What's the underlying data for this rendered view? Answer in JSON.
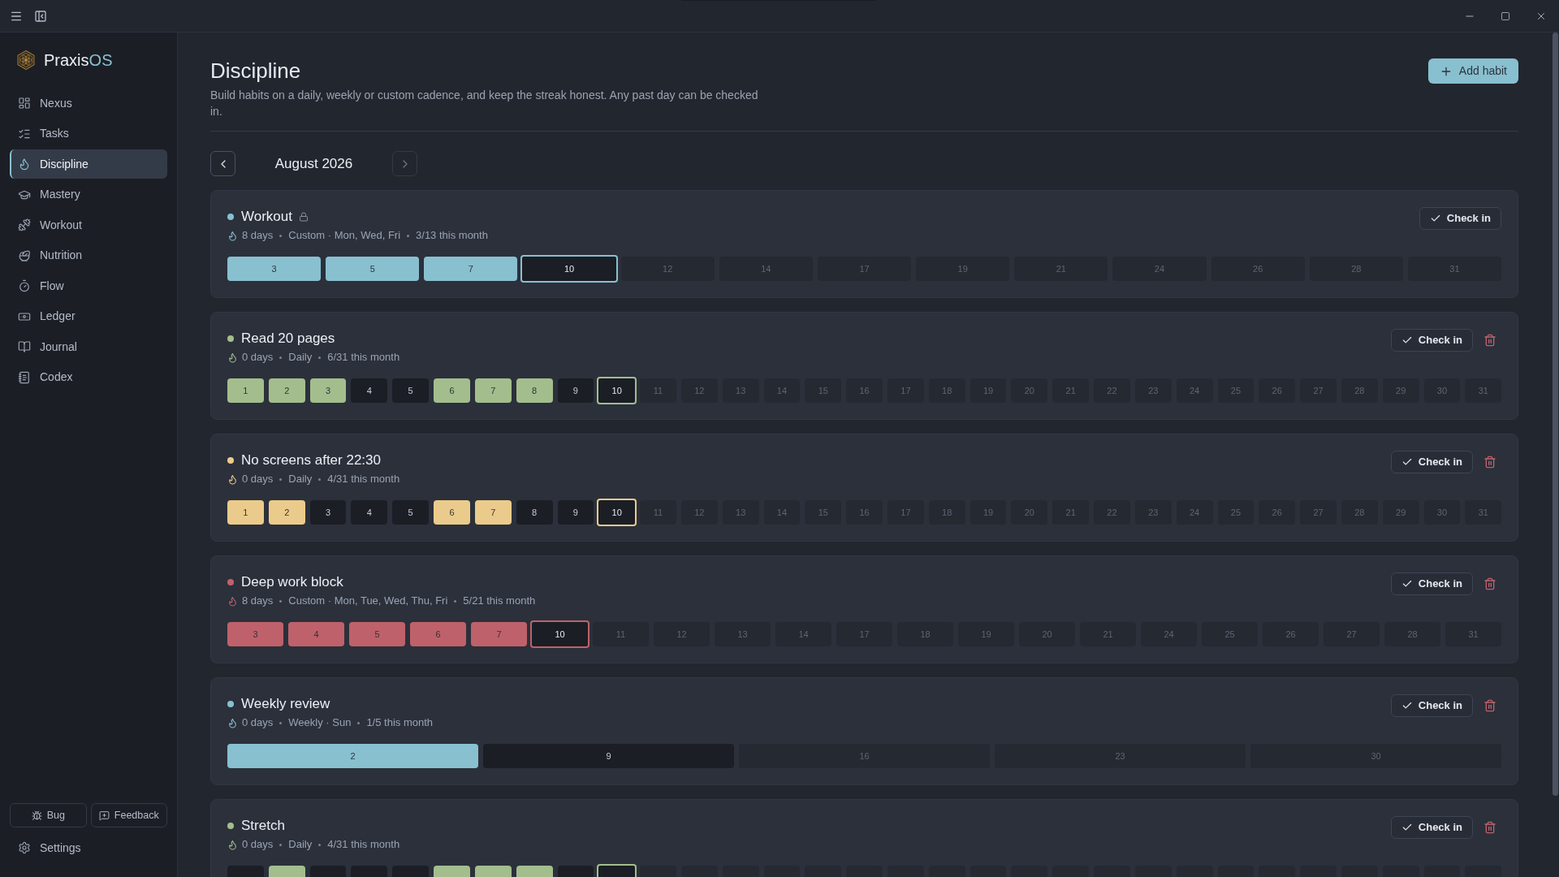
{
  "sidebar": {
    "brand": {
      "name": "Praxis",
      "accent": "OS"
    },
    "items": [
      {
        "label": "Nexus",
        "selected": false
      },
      {
        "label": "Tasks",
        "selected": false
      },
      {
        "label": "Discipline",
        "selected": true
      },
      {
        "label": "Mastery",
        "selected": false
      },
      {
        "label": "Workout",
        "selected": false
      },
      {
        "label": "Nutrition",
        "selected": false
      },
      {
        "label": "Flow",
        "selected": false
      },
      {
        "label": "Ledger",
        "selected": false
      },
      {
        "label": "Journal",
        "selected": false
      },
      {
        "label": "Codex",
        "selected": false
      }
    ],
    "footer_buttons": [
      "Bug",
      "Feedback"
    ],
    "settings": "Settings"
  },
  "page": {
    "title": "Discipline",
    "description": "Build habits on a daily, weekly or custom cadence, and keep the streak honest. Any past day can be checked in.",
    "add_button": "Add habit"
  },
  "month_nav": {
    "label": "August 2026",
    "prev": {
      "disabled": false
    },
    "next": {
      "disabled": true
    }
  },
  "habits": [
    {
      "name": "Workout",
      "color": "#88c0d0",
      "locked": true,
      "meta": [
        "8 days",
        "Custom · Mon, Wed, Fri",
        "3/13 this month"
      ],
      "check_in": "Check in",
      "days": [
        {
          "label": "3",
          "kind": "done"
        },
        {
          "label": "5",
          "kind": "done"
        },
        {
          "label": "7",
          "kind": "done"
        },
        {
          "label": "10",
          "kind": "today"
        },
        {
          "label": "12",
          "kind": "upcoming"
        },
        {
          "label": "14",
          "kind": "upcoming"
        },
        {
          "label": "17",
          "kind": "upcoming"
        },
        {
          "label": "19",
          "kind": "upcoming"
        },
        {
          "label": "21",
          "kind": "upcoming"
        },
        {
          "label": "24",
          "kind": "upcoming"
        },
        {
          "label": "26",
          "kind": "upcoming"
        },
        {
          "label": "28",
          "kind": "upcoming"
        },
        {
          "label": "31",
          "kind": "upcoming"
        }
      ]
    },
    {
      "name": "Read 20 pages",
      "color": "#a3be8c",
      "locked": false,
      "meta": [
        "0 days",
        "Daily",
        "6/31 this month"
      ],
      "check_in": "Check in",
      "days": [
        {
          "label": "1",
          "kind": "done"
        },
        {
          "label": "2",
          "kind": "done"
        },
        {
          "label": "3",
          "kind": "done"
        },
        {
          "label": "4",
          "kind": "missed"
        },
        {
          "label": "5",
          "kind": "missed"
        },
        {
          "label": "6",
          "kind": "done"
        },
        {
          "label": "7",
          "kind": "done"
        },
        {
          "label": "8",
          "kind": "done"
        },
        {
          "label": "9",
          "kind": "missed"
        },
        {
          "label": "10",
          "kind": "today"
        },
        {
          "label": "11",
          "kind": "upcoming"
        },
        {
          "label": "12",
          "kind": "upcoming"
        },
        {
          "label": "13",
          "kind": "upcoming"
        },
        {
          "label": "14",
          "kind": "upcoming"
        },
        {
          "label": "15",
          "kind": "upcoming"
        },
        {
          "label": "16",
          "kind": "upcoming"
        },
        {
          "label": "17",
          "kind": "upcoming"
        },
        {
          "label": "18",
          "kind": "upcoming"
        },
        {
          "label": "19",
          "kind": "upcoming"
        },
        {
          "label": "20",
          "kind": "upcoming"
        },
        {
          "label": "21",
          "kind": "upcoming"
        },
        {
          "label": "22",
          "kind": "upcoming"
        },
        {
          "label": "23",
          "kind": "upcoming"
        },
        {
          "label": "24",
          "kind": "upcoming"
        },
        {
          "label": "25",
          "kind": "upcoming"
        },
        {
          "label": "26",
          "kind": "upcoming"
        },
        {
          "label": "27",
          "kind": "upcoming"
        },
        {
          "label": "28",
          "kind": "upcoming"
        },
        {
          "label": "29",
          "kind": "upcoming"
        },
        {
          "label": "30",
          "kind": "upcoming"
        },
        {
          "label": "31",
          "kind": "upcoming"
        }
      ]
    },
    {
      "name": "No screens after 22:30",
      "color": "#ebcb8b",
      "locked": false,
      "meta": [
        "0 days",
        "Daily",
        "4/31 this month"
      ],
      "check_in": "Check in",
      "days": [
        {
          "label": "1",
          "kind": "done"
        },
        {
          "label": "2",
          "kind": "done"
        },
        {
          "label": "3",
          "kind": "missed"
        },
        {
          "label": "4",
          "kind": "missed"
        },
        {
          "label": "5",
          "kind": "missed"
        },
        {
          "label": "6",
          "kind": "done"
        },
        {
          "label": "7",
          "kind": "done"
        },
        {
          "label": "8",
          "kind": "missed"
        },
        {
          "label": "9",
          "kind": "missed"
        },
        {
          "label": "10",
          "kind": "today"
        },
        {
          "label": "11",
          "kind": "upcoming"
        },
        {
          "label": "12",
          "kind": "upcoming"
        },
        {
          "label": "13",
          "kind": "upcoming"
        },
        {
          "label": "14",
          "kind": "upcoming"
        },
        {
          "label": "15",
          "kind": "upcoming"
        },
        {
          "label": "16",
          "kind": "upcoming"
        },
        {
          "label": "17",
          "kind": "upcoming"
        },
        {
          "label": "18",
          "kind": "upcoming"
        },
        {
          "label": "19",
          "kind": "upcoming"
        },
        {
          "label": "20",
          "kind": "upcoming"
        },
        {
          "label": "21",
          "kind": "upcoming"
        },
        {
          "label": "22",
          "kind": "upcoming"
        },
        {
          "label": "23",
          "kind": "upcoming"
        },
        {
          "label": "24",
          "kind": "upcoming"
        },
        {
          "label": "25",
          "kind": "upcoming"
        },
        {
          "label": "26",
          "kind": "upcoming"
        },
        {
          "label": "27",
          "kind": "upcoming"
        },
        {
          "label": "28",
          "kind": "upcoming"
        },
        {
          "label": "29",
          "kind": "upcoming"
        },
        {
          "label": "30",
          "kind": "upcoming"
        },
        {
          "label": "31",
          "kind": "upcoming"
        }
      ]
    },
    {
      "name": "Deep work block",
      "color": "#bf616a",
      "locked": false,
      "meta": [
        "8 days",
        "Custom · Mon, Tue, Wed, Thu, Fri",
        "5/21 this month"
      ],
      "check_in": "Check in",
      "days": [
        {
          "label": "3",
          "kind": "done"
        },
        {
          "label": "4",
          "kind": "done"
        },
        {
          "label": "5",
          "kind": "done"
        },
        {
          "label": "6",
          "kind": "done"
        },
        {
          "label": "7",
          "kind": "done"
        },
        {
          "label": "10",
          "kind": "today"
        },
        {
          "label": "11",
          "kind": "upcoming"
        },
        {
          "label": "12",
          "kind": "upcoming"
        },
        {
          "label": "13",
          "kind": "upcoming"
        },
        {
          "label": "14",
          "kind": "upcoming"
        },
        {
          "label": "17",
          "kind": "upcoming"
        },
        {
          "label": "18",
          "kind": "upcoming"
        },
        {
          "label": "19",
          "kind": "upcoming"
        },
        {
          "label": "20",
          "kind": "upcoming"
        },
        {
          "label": "21",
          "kind": "upcoming"
        },
        {
          "label": "24",
          "kind": "upcoming"
        },
        {
          "label": "25",
          "kind": "upcoming"
        },
        {
          "label": "26",
          "kind": "upcoming"
        },
        {
          "label": "27",
          "kind": "upcoming"
        },
        {
          "label": "28",
          "kind": "upcoming"
        },
        {
          "label": "31",
          "kind": "upcoming"
        }
      ]
    },
    {
      "name": "Weekly review",
      "color": "#88c0d0",
      "locked": false,
      "meta": [
        "0 days",
        "Weekly · Sun",
        "1/5 this month"
      ],
      "check_in": "Check in",
      "days": [
        {
          "label": "2",
          "kind": "done"
        },
        {
          "label": "9",
          "kind": "missed"
        },
        {
          "label": "16",
          "kind": "upcoming"
        },
        {
          "label": "23",
          "kind": "upcoming"
        },
        {
          "label": "30",
          "kind": "upcoming"
        }
      ]
    },
    {
      "name": "Stretch",
      "color": "#a3be8c",
      "locked": false,
      "meta": [
        "0 days",
        "Daily",
        "4/31 this month"
      ],
      "check_in": "Check in",
      "days": [
        {
          "kind": "missed"
        },
        {
          "kind": "done"
        },
        {
          "kind": "missed"
        },
        {
          "kind": "missed"
        },
        {
          "kind": "missed"
        },
        {
          "kind": "done"
        },
        {
          "kind": "done"
        },
        {
          "kind": "done"
        },
        {
          "kind": "missed"
        },
        {
          "kind": "today"
        },
        {
          "kind": "upcoming"
        },
        {
          "kind": "upcoming"
        },
        {
          "kind": "upcoming"
        },
        {
          "kind": "upcoming"
        },
        {
          "kind": "upcoming"
        },
        {
          "kind": "upcoming"
        },
        {
          "kind": "upcoming"
        },
        {
          "kind": "upcoming"
        },
        {
          "kind": "upcoming"
        },
        {
          "kind": "upcoming"
        },
        {
          "kind": "upcoming"
        },
        {
          "kind": "upcoming"
        },
        {
          "kind": "upcoming"
        },
        {
          "kind": "upcoming"
        },
        {
          "kind": "upcoming"
        },
        {
          "kind": "upcoming"
        },
        {
          "kind": "upcoming"
        },
        {
          "kind": "upcoming"
        },
        {
          "kind": "upcoming"
        },
        {
          "kind": "upcoming"
        },
        {
          "kind": "upcoming"
        }
      ]
    }
  ]
}
